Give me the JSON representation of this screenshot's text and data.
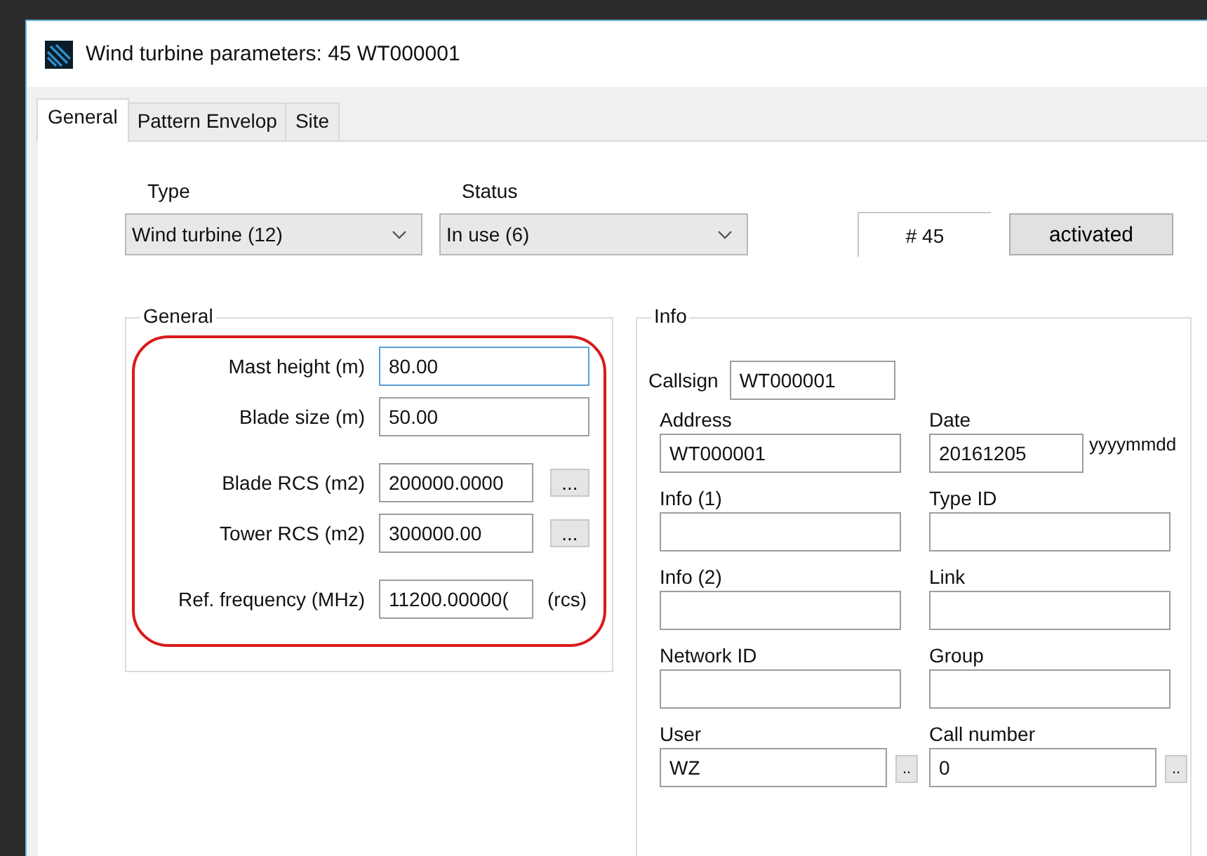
{
  "window": {
    "title": "Wind turbine parameters: 45 WT000001"
  },
  "tabs": [
    {
      "label": "General",
      "selected": true
    },
    {
      "label": "Pattern Envelop",
      "selected": false
    },
    {
      "label": "Site",
      "selected": false
    }
  ],
  "type": {
    "label": "Type",
    "value": "Wind turbine (12)"
  },
  "status": {
    "label": "Status",
    "value": "In use (6)"
  },
  "number": "# 45",
  "state_button": "activated",
  "general": {
    "title": "General",
    "highlighted": true,
    "sections": [
      [
        {
          "label": "Mast height (m)",
          "value": "80.00",
          "focused": true
        },
        {
          "label": "Blade size (m)",
          "value": "50.00",
          "focused": false
        }
      ],
      [
        {
          "label": "Blade RCS (m2)",
          "value": "200000.0000",
          "focused": false,
          "button": "..."
        },
        {
          "label": "Tower RCS (m2)",
          "value": "300000.00",
          "focused": false,
          "button": "..."
        }
      ],
      [
        {
          "label": "Ref. frequency (MHz)",
          "value": "11200.00000(",
          "focused": false,
          "suffix": "(rcs)"
        }
      ]
    ]
  },
  "info": {
    "title": "Info",
    "callsign": {
      "label": "Callsign",
      "value": "WT000001"
    },
    "fields": [
      {
        "label": "Address",
        "value": "WT000001"
      },
      {
        "label": "Date",
        "value": "20161205",
        "suffix": "yyyymmdd"
      },
      {
        "label": "Info (1)"
      },
      {
        "label": "Type ID"
      },
      {
        "label": "Info (2)"
      },
      {
        "label": "Link"
      },
      {
        "label": "Network ID"
      },
      {
        "label": "Group"
      },
      {
        "label": "User",
        "value": "WZ",
        "button": ".."
      },
      {
        "label": "Call number",
        "value": "0",
        "button": ".."
      }
    ]
  }
}
